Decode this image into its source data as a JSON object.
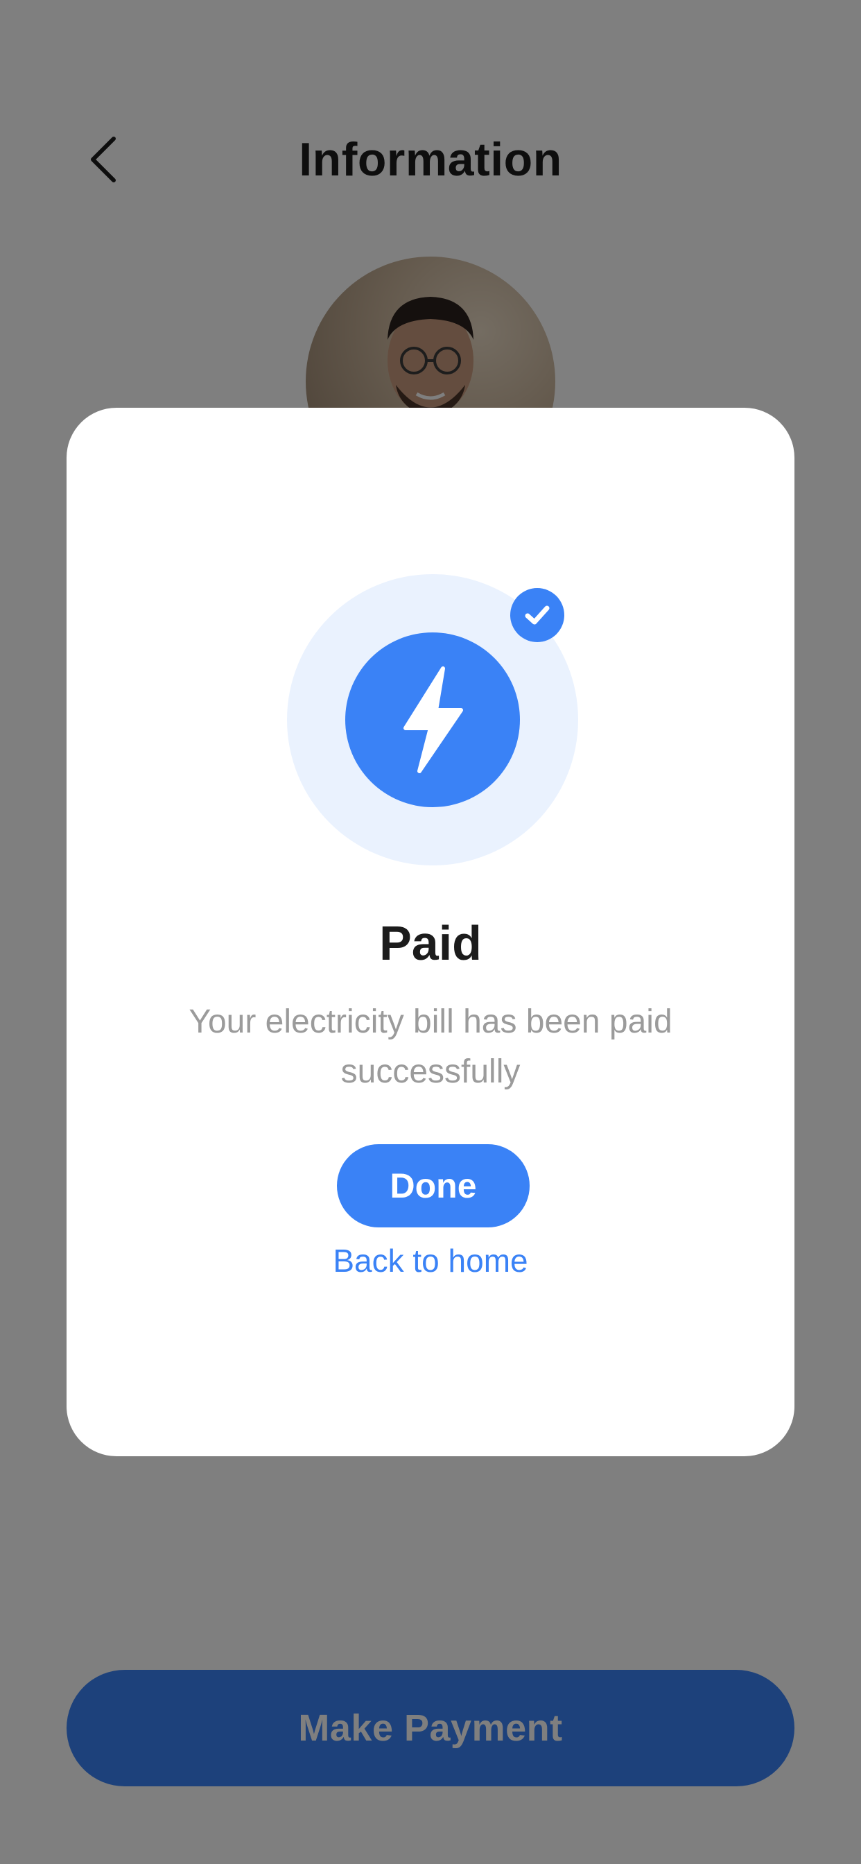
{
  "header": {
    "title": "Information",
    "back_icon": "chevron-left-icon"
  },
  "footer": {
    "make_payment_label": "Make Payment"
  },
  "modal": {
    "title": "Paid",
    "message": "Your electricity bill has been paid successfully",
    "done_label": "Done",
    "back_home_label": "Back to home",
    "main_icon": "lightning-bolt-icon",
    "badge_icon": "check-icon"
  },
  "colors": {
    "accent": "#3a82f6",
    "halo": "#eaf2fe",
    "overlay": "rgba(0,0,0,0.5)",
    "text_primary": "#1c1c1c",
    "text_muted": "#9b9b9b"
  }
}
